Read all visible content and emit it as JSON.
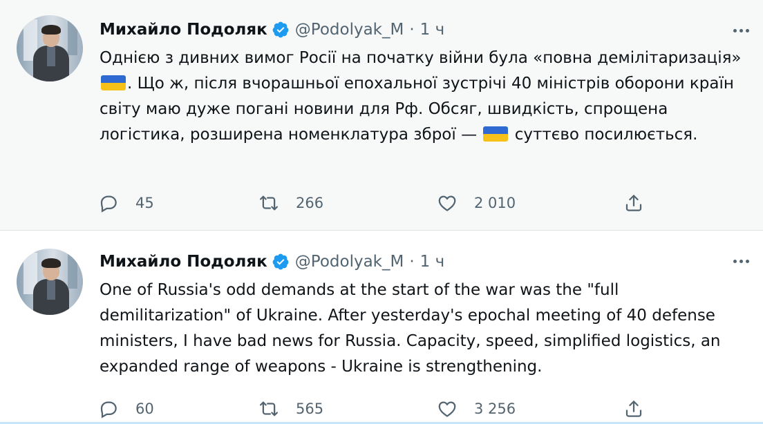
{
  "tweets": [
    {
      "author_name": "Михайло Подоляк",
      "handle": "@Podolyak_M",
      "separator": "·",
      "time": "1 ч",
      "text_parts": [
        "Однією з дивних вимог Росії на початку війни була «повна демілітаризація» ",
        ". Що ж, після вчорашньої епохальної зустрічі 40 міністрів оборони країн світу маю дуже погані новини для Рф. Обсяг, швидкість, спрощена логістика, розширена номенклатура зброї — ",
        " суттєво посилюється."
      ],
      "reply_count": "45",
      "retweet_count": "266",
      "like_count": "2 010"
    },
    {
      "author_name": "Михайло Подоляк",
      "handle": "@Podolyak_M",
      "separator": "·",
      "time": "1 ч",
      "text": "One of Russia's odd demands at the start of the war was the \"full demilitarization\" of Ukraine. After yesterday's epochal meeting of 40 defense ministers, I have bad news for Russia. Capacity, speed, simplified logistics, an expanded range of weapons - Ukraine is strengthening.",
      "reply_count": "60",
      "retweet_count": "565",
      "like_count": "3 256"
    }
  ],
  "icons": {
    "verified": "verified-badge-icon",
    "more": "more-options-icon",
    "reply": "reply-icon",
    "retweet": "retweet-icon",
    "like": "like-icon",
    "share": "share-icon",
    "flag": "ukraine-flag-emoji"
  },
  "colors": {
    "verified_blue": "#1d9bf0",
    "secondary_text": "#536471",
    "flag_blue": "#2e6ad1",
    "flag_yellow": "#f6c21a"
  }
}
